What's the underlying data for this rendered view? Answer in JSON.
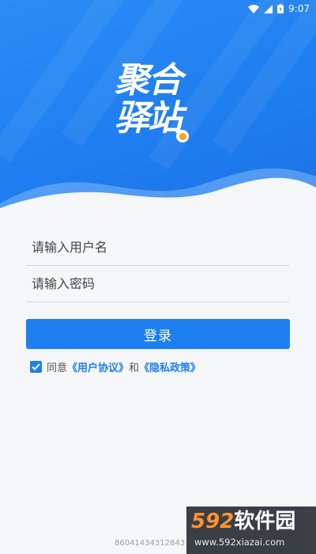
{
  "status_bar": {
    "time": "9:07"
  },
  "logo": {
    "line1": "聚合",
    "line2": "驿站"
  },
  "form": {
    "username_placeholder": "请输入用户名",
    "password_placeholder": "请输入密码",
    "login_label": "登录"
  },
  "agreement": {
    "checked": true,
    "prefix": "同意",
    "user_agreement": "《用户协议》",
    "and": "和",
    "privacy_policy": "《隐私政策》"
  },
  "device_id": "86041434312843",
  "watermark": {
    "number": "592",
    "name": "软件园",
    "url": "www.592xiazai.com"
  },
  "colors": {
    "primary": "#1e7ff0",
    "accent": "#f3a323"
  },
  "icons": [
    "wifi-icon",
    "signal-icon",
    "battery-icon",
    "checkmark-icon"
  ]
}
